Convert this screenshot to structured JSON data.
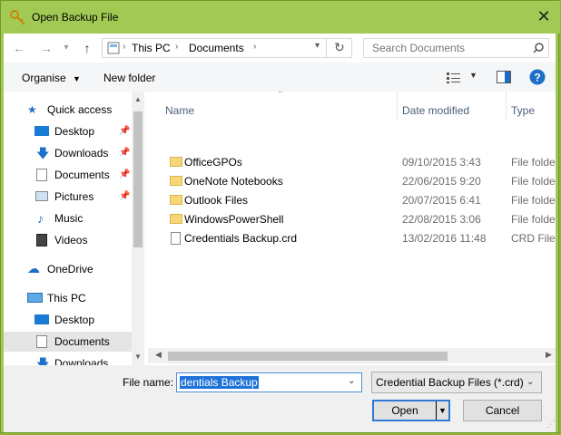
{
  "window": {
    "title": "Open Backup File"
  },
  "address": {
    "path": [
      "This PC",
      "Documents"
    ],
    "search_placeholder": "Search Documents"
  },
  "toolbar": {
    "organise": "Organise",
    "new_folder": "New folder"
  },
  "nav": {
    "items": [
      {
        "label": "Quick access",
        "icon": "star-icon"
      },
      {
        "label": "Desktop",
        "icon": "desktop-icon",
        "pinned": true
      },
      {
        "label": "Downloads",
        "icon": "download-icon",
        "pinned": true
      },
      {
        "label": "Documents",
        "icon": "documents-icon",
        "pinned": true
      },
      {
        "label": "Pictures",
        "icon": "pictures-icon",
        "pinned": true
      },
      {
        "label": "Music",
        "icon": "music-icon"
      },
      {
        "label": "Videos",
        "icon": "videos-icon"
      },
      {
        "label": "OneDrive",
        "icon": "cloud-icon"
      },
      {
        "label": "This PC",
        "icon": "computer-icon"
      },
      {
        "label": "Desktop",
        "icon": "desktop-icon"
      },
      {
        "label": "Documents",
        "icon": "documents-icon",
        "selected": true
      },
      {
        "label": "Downloads",
        "icon": "download-icon"
      }
    ]
  },
  "files": {
    "columns": {
      "name": "Name",
      "date": "Date modified",
      "type": "Type"
    },
    "rows": [
      {
        "name": "OfficeGPOs",
        "date": "09/10/2015 3:43",
        "type": "File folder",
        "kind": "folder"
      },
      {
        "name": "OneNote Notebooks",
        "date": "22/06/2015 9:20",
        "type": "File folder",
        "kind": "folder"
      },
      {
        "name": "Outlook Files",
        "date": "20/07/2015 6:41",
        "type": "File folder",
        "kind": "folder"
      },
      {
        "name": "WindowsPowerShell",
        "date": "22/08/2015 3:06",
        "type": "File folder",
        "kind": "folder"
      },
      {
        "name": "Credentials Backup.crd",
        "date": "13/02/2016 11:48",
        "type": "CRD File",
        "kind": "file"
      }
    ]
  },
  "bottom": {
    "filename_label": "File name:",
    "filename_value": "dentials Backup",
    "filetype_value": "Credential Backup Files (*.crd)",
    "open_label": "Open",
    "cancel_label": "Cancel"
  },
  "colors": {
    "accent": "#a2c954",
    "selection": "#1e73d8",
    "selected_nav": "#e5e5e5"
  }
}
